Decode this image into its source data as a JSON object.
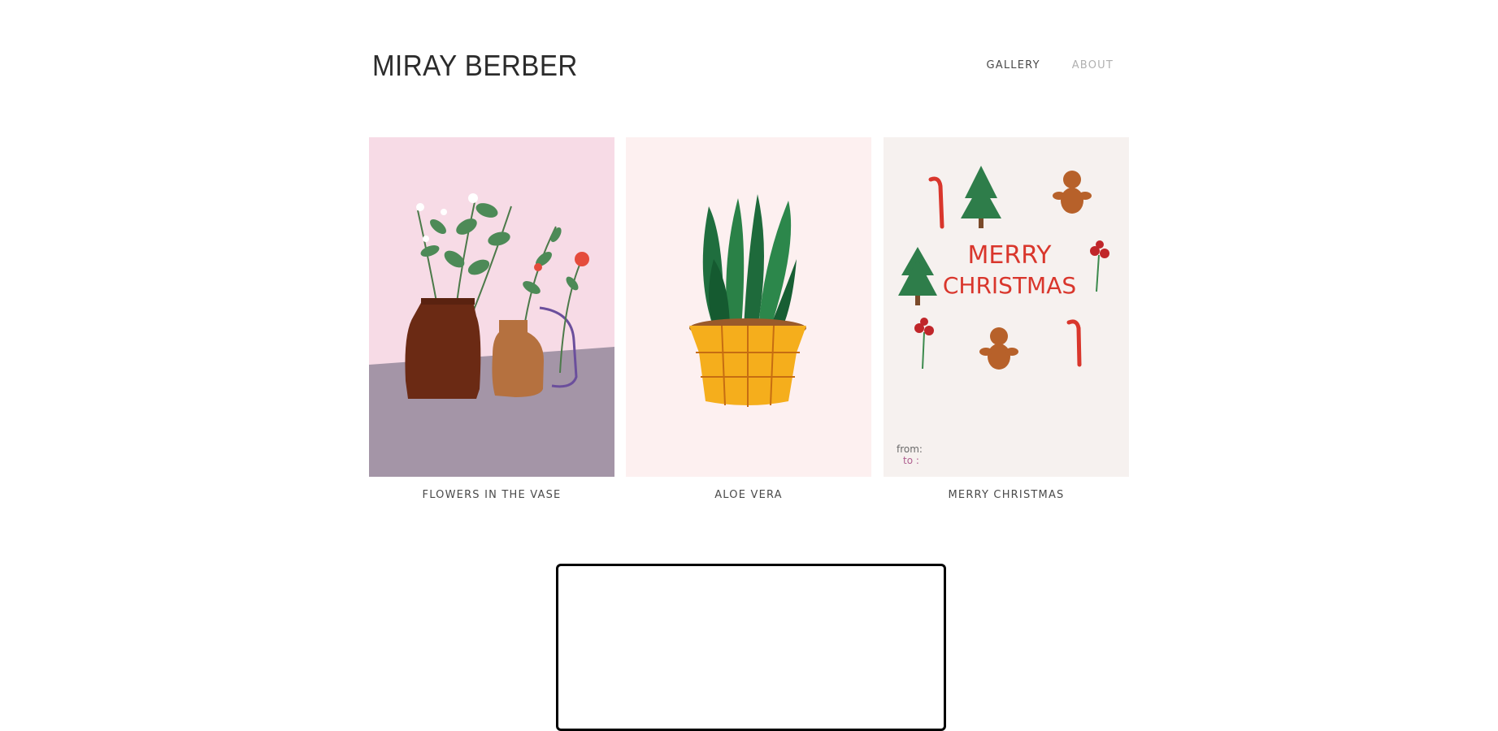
{
  "site": {
    "title": "MIRAY BERBER"
  },
  "nav": {
    "items": [
      {
        "label": "GALLERY",
        "active": true
      },
      {
        "label": "ABOUT",
        "active": false
      }
    ]
  },
  "gallery": {
    "items": [
      {
        "caption": "FLOWERS IN THE VASE",
        "image": "flowers-in-vase-illustration"
      },
      {
        "caption": "ALOE VERA",
        "image": "aloe-vera-illustration"
      },
      {
        "caption": "MERRY CHRISTMAS",
        "image": "merry-christmas-illustration",
        "art_text": "MERRY\nCHRISTMAS",
        "art_from": "from:",
        "art_to": "to :"
      }
    ]
  },
  "colors": {
    "text": "#2b2b2b",
    "nav_active": "#4a4a4a",
    "nav_inactive": "#b0b0b0"
  }
}
